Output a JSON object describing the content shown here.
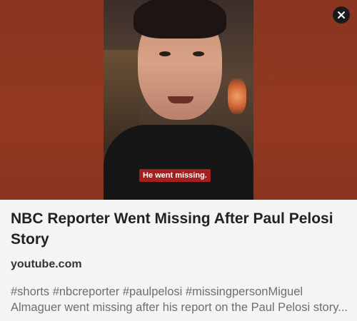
{
  "preview": {
    "caption": "He went missing.",
    "close_icon": "close-icon",
    "background_color": "#8c3620"
  },
  "link": {
    "title": "NBC Reporter Went Missing After Paul Pelosi Story",
    "domain": "youtube.com",
    "description": "#shorts #nbcreporter #paulpelosi #missingpersonMiguel Almaguer went missing after his report on the Paul Pelosi story..."
  }
}
